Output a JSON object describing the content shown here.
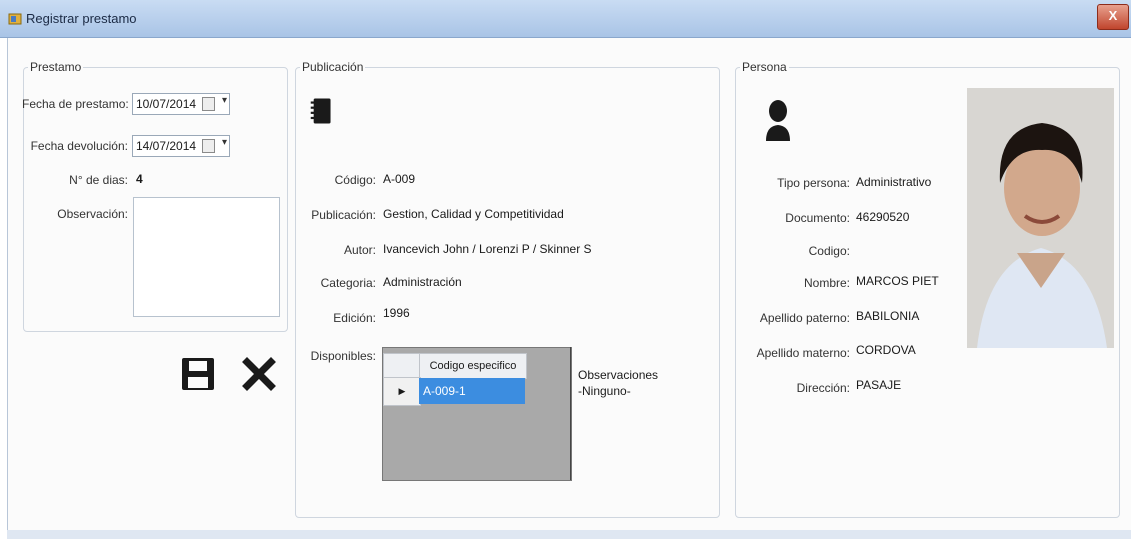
{
  "window": {
    "title": "Registrar prestamo",
    "close_label": "X"
  },
  "prestamo": {
    "legend": "Prestamo",
    "fecha_prestamo_label": "Fecha de prestamo:",
    "fecha_prestamo_value": "10/07/2014",
    "fecha_devolucion_label": "Fecha devolución:",
    "fecha_devolucion_value": "14/07/2014",
    "dias_label": "N° de dias:",
    "dias_value": "4",
    "observacion_label": "Observación:",
    "observacion_value": ""
  },
  "actions": {
    "save_icon": "save-floppy-icon",
    "cancel_icon": "close-x-icon"
  },
  "publicacion": {
    "legend": "Publicación",
    "icon": "notebook-icon",
    "codigo_label": "Código:",
    "codigo_value": "A-009",
    "publicacion_label": "Publicación:",
    "publicacion_value": "Gestion, Calidad y Competitividad",
    "autor_label": "Autor:",
    "autor_value": "Ivancevich John / Lorenzi P / Skinner S",
    "categoria_label": "Categoria:",
    "categoria_value": "Administración",
    "edicion_label": "Edición:",
    "edicion_value": "1996",
    "disponibles_label": "Disponibles:",
    "grid": {
      "column_header": "Codigo especifico",
      "rows": [
        {
          "marker": "▶",
          "value": "A-009-1"
        }
      ]
    },
    "observaciones_label": "Observaciones",
    "observaciones_value": "-Ninguno-"
  },
  "persona": {
    "legend": "Persona",
    "icon": "person-silhouette-icon",
    "tipo_label": "Tipo persona:",
    "tipo_value": "Administrativo",
    "documento_label": "Documento:",
    "documento_value": "46290520",
    "codigo_label": "Codigo:",
    "codigo_value": "",
    "nombre_label": "Nombre:",
    "nombre_value": "MARCOS PIET",
    "ap_paterno_label": "Apellido paterno:",
    "ap_paterno_value": "BABILONIA",
    "ap_materno_label": "Apellido materno:",
    "ap_materno_value": "CORDOVA",
    "direccion_label": "Dirección:",
    "direccion_value": "PASAJE"
  }
}
